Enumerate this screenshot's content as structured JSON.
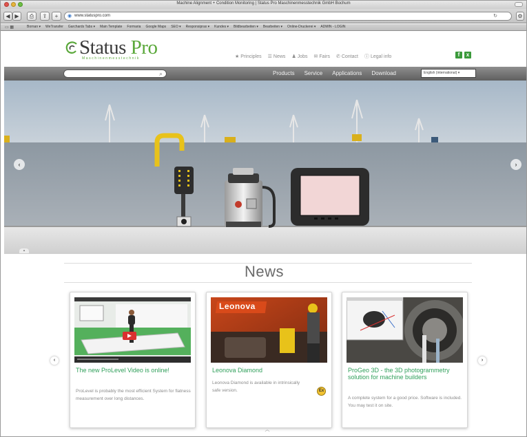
{
  "browser": {
    "window_title": "Machine Alignment + Condition Monitoring | Status Pro Maschinenmesstechnik GmbH Bochum",
    "url": "www.statuspro.com",
    "bookmarks": [
      "Bornan ▾",
      "WeTransfer",
      "Garchards Tabs ▾",
      "Main Template",
      "Formaria",
      "Google Maps",
      "SEO ▾",
      "Responsiprax ▾",
      "Kundes ▾",
      "Bildbearbeiten ▾",
      "Bearbeiten ▾",
      "Online-Druckerei ▾",
      "ADMIN - LOGIN"
    ]
  },
  "site": {
    "logo_main": "Status",
    "logo_pro": "Pro",
    "logo_sub": "Maschinenmesstechnik",
    "topnav": [
      {
        "icon": "★",
        "label": "Principles"
      },
      {
        "icon": "☰",
        "label": "News"
      },
      {
        "icon": "♟",
        "label": "Jobs"
      },
      {
        "icon": "✉",
        "label": "Fairs"
      },
      {
        "icon": "✆",
        "label": "Contact"
      },
      {
        "icon": "ⓘ",
        "label": "Legal info"
      }
    ],
    "social": {
      "facebook": "f",
      "xing": "x"
    }
  },
  "navbar": {
    "search_placeholder": "",
    "menu": [
      "Products",
      "Service",
      "Applications",
      "Download"
    ],
    "language": "English (international) ▾"
  },
  "news": {
    "heading": "News",
    "cards": [
      {
        "title": "The new ProLevel Video is online!",
        "text": "ProLevel is probably the most efficient System for flatness measurement over long distances."
      },
      {
        "title": "Leonova Diamond",
        "text": "Leonova Diamond is available in intrinsically safe version.",
        "badge": "Ex",
        "image_brand": "Leonova"
      },
      {
        "title": "ProGeo 3D - the 3D photogrammetry solution for machine builders",
        "text": "A complete system for a good price. Software is included. You may test it on site."
      }
    ]
  }
}
